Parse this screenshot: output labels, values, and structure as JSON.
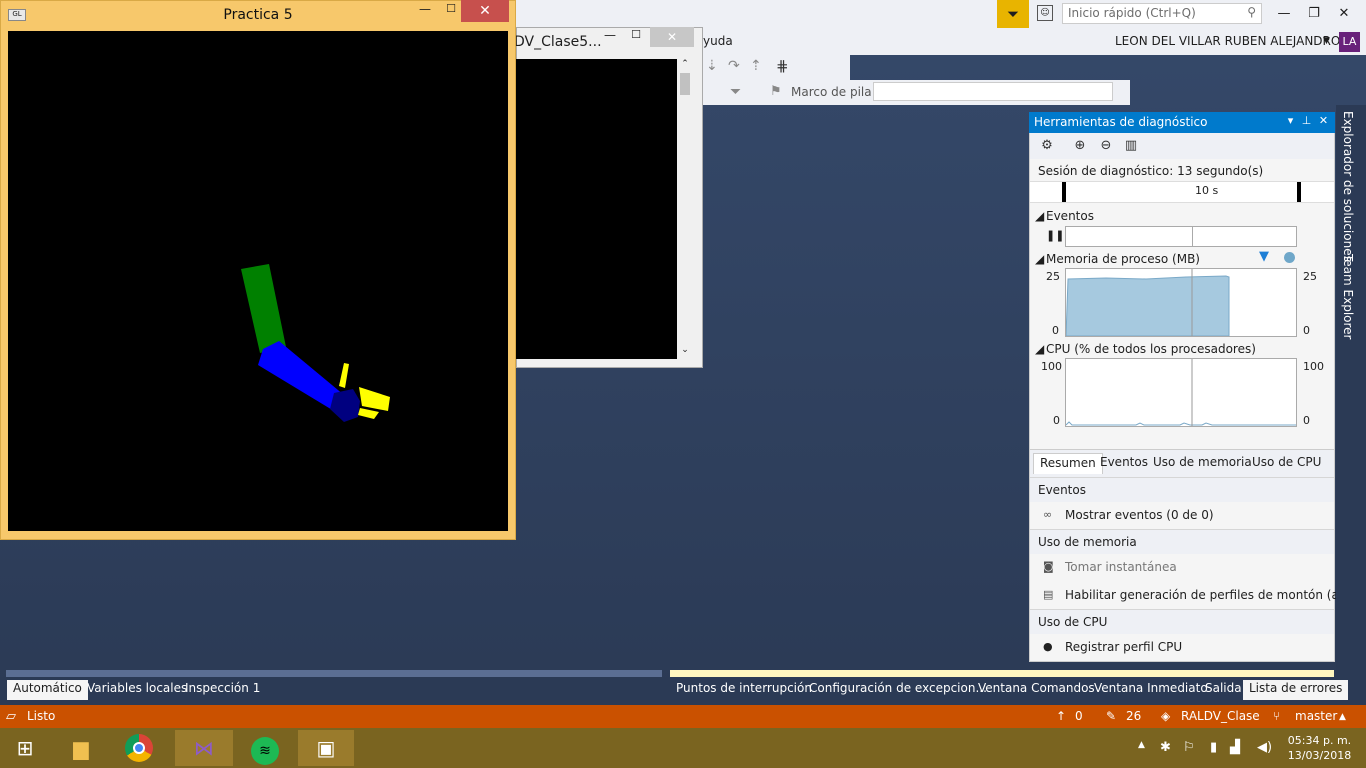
{
  "vs": {
    "quick_launch_placeholder": "Inicio rápido (Ctrl+Q)",
    "menu_tail": "yuda",
    "user_name": "LEON DEL VILLAR RUBEN ALEJANDRO",
    "avatar_initials": "LA",
    "marco_label": "Marco de pila:",
    "side_tabs": [
      "Explorador de soluciones",
      "Team Explorer"
    ],
    "left_tabs": [
      "Automático",
      "Variables locales",
      "Inspección 1"
    ],
    "right_tabs": [
      "Puntos de interrupción",
      "Configuración de excepcion...",
      "Ventana Comandos",
      "Ventana Inmediato",
      "Salida",
      "Lista de errores"
    ]
  },
  "console2": {
    "title": "DV_Clase5..."
  },
  "practica": {
    "title": "Practica 5"
  },
  "diag": {
    "title": "Herramientas de diagnóstico",
    "session": "Sesión de diagnóstico: 13 segundo(s)",
    "ruler_label": "10 s",
    "events_label": "Eventos",
    "memory_label": "Memoria de proceso (MB)",
    "mem_max": "25",
    "mem_min": "0",
    "cpu_label": "CPU (% de todos los procesadores)",
    "cpu_max": "100",
    "cpu_min": "0",
    "tabs": [
      "Resumen",
      "Eventos",
      "Uso de memoria",
      "Uso de CPU"
    ],
    "sec_events": "Eventos",
    "act_show_events": "Mostrar eventos (0 de 0)",
    "sec_memory": "Uso de memoria",
    "act_snapshot": "Tomar instantánea",
    "act_heap": "Habilitar generación de perfiles de montón (afec",
    "sec_cpu": "Uso de CPU",
    "act_cpu": "Registrar perfil CPU"
  },
  "status": {
    "ready": "Listo",
    "up_count": "0",
    "edit_count": "26",
    "repo": "RALDV_Clase",
    "branch": "master"
  },
  "taskbar": {
    "time": "05:34 p. m.",
    "date": "13/03/2018"
  },
  "colors": {
    "accent": "#007acc",
    "status_bar": "#ca5100",
    "upper_arm": "#008000",
    "forearm": "#0000ff",
    "hand": "#000080",
    "fingers": "#ffff00"
  }
}
